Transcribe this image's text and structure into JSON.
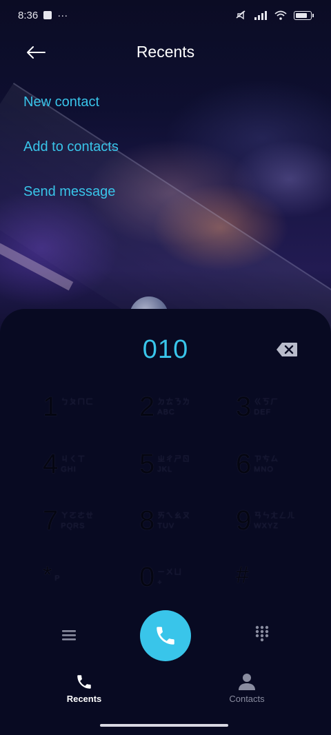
{
  "status": {
    "time": "8:36",
    "extra": "···"
  },
  "header": {
    "title": "Recents"
  },
  "options": [
    {
      "label": "New contact"
    },
    {
      "label": "Add to contacts"
    },
    {
      "label": "Send message"
    }
  ],
  "dialer": {
    "number": "010",
    "keys": [
      {
        "digit": "1",
        "bopo": "ㄅㄆㄇㄈ",
        "letters": ""
      },
      {
        "digit": "2",
        "bopo": "ㄉㄊㄋㄌ",
        "letters": "ABC"
      },
      {
        "digit": "3",
        "bopo": "ㄍㄎㄏ",
        "letters": "DEF"
      },
      {
        "digit": "4",
        "bopo": "ㄐㄑㄒ",
        "letters": "GHI"
      },
      {
        "digit": "5",
        "bopo": "ㄓㄔㄕㄖ",
        "letters": "JKL"
      },
      {
        "digit": "6",
        "bopo": "ㄗㄘㄙ",
        "letters": "MNO"
      },
      {
        "digit": "7",
        "bopo": "ㄚㄛㄜㄝ",
        "letters": "PQRS"
      },
      {
        "digit": "8",
        "bopo": "ㄞㄟㄠㄡ",
        "letters": "TUV"
      },
      {
        "digit": "9",
        "bopo": "ㄢㄣㄤㄥㄦ",
        "letters": "WXYZ"
      },
      {
        "digit": "*",
        "bopo": "",
        "letters": "P"
      },
      {
        "digit": "0",
        "bopo": "ㄧㄨㄩ",
        "letters": "+"
      },
      {
        "digit": "#",
        "bopo": "",
        "letters": ""
      }
    ]
  },
  "nav": {
    "recents": "Recents",
    "contacts": "Contacts"
  },
  "colors": {
    "accent": "#39c5ea",
    "background": "#090a1e"
  }
}
